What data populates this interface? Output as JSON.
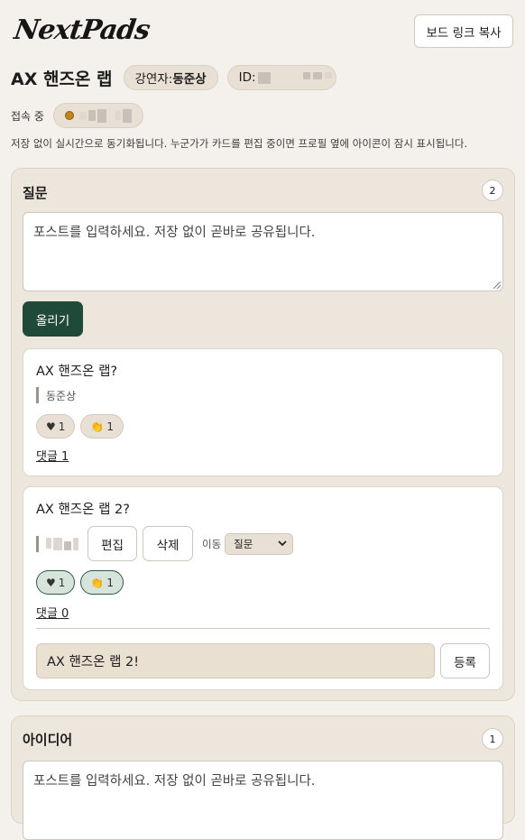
{
  "app": {
    "logo": "NextPads"
  },
  "header": {
    "copy_link_label": "보드 링크 복사"
  },
  "board": {
    "title": "AX 핸즈온 랩",
    "instructor_label": "강연자:",
    "instructor_name": "동준상",
    "id_label": "ID:",
    "connected_label": "접속 중",
    "notice": "저장 없이 실시간으로 동기화됩니다. 누군가가 카드를 편집 중이면 프로필 옆에 아이콘이 잠시 표시됩니다."
  },
  "columns": [
    {
      "title": "질문",
      "count": "2",
      "input_placeholder": "포스트를 입력하세요. 저장 없이 곧바로 공유됩니다.",
      "submit_label": "올리기",
      "cards": [
        {
          "title": "AX 핸즈온 랩?",
          "author": "동준상",
          "hearts": "1",
          "claps": "1",
          "comments_label": "댓글 1"
        },
        {
          "title": "AX 핸즈온 랩 2?",
          "edit_label": "편집",
          "delete_label": "삭제",
          "move_label": "이동",
          "move_value": "질문",
          "hearts": "1",
          "claps": "1",
          "comments_label": "댓글 0",
          "comment_input_value": "AX 핸즈온 랩 2!",
          "comment_submit_label": "등록"
        }
      ]
    },
    {
      "title": "아이디어",
      "count": "1",
      "input_placeholder": "포스트를 입력하세요. 저장 없이 곧바로 공유됩니다."
    }
  ],
  "icons": {
    "heart": "♥",
    "clap": "👏",
    "chevron": "chevron-down-icon"
  },
  "colors": {
    "primary": "#1f4a3a",
    "background": "#f4f1ec",
    "column_bg": "#ede6dc",
    "presence_dot": "#c28616"
  }
}
